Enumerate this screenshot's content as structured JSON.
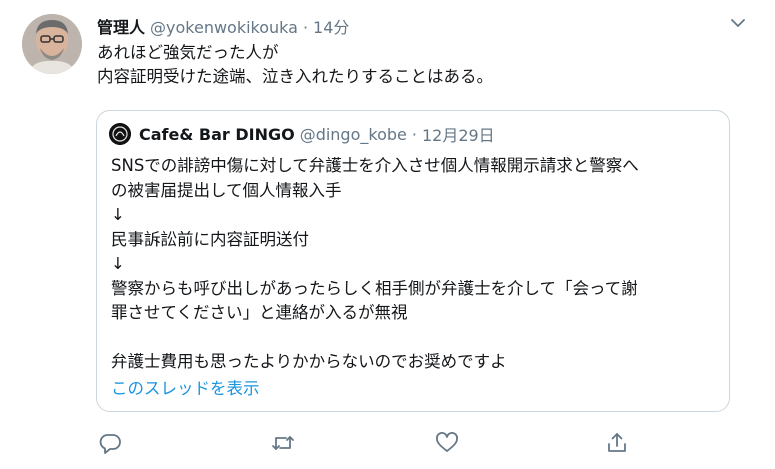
{
  "tweet": {
    "display_name": "管理人",
    "handle": "@yokenwokikouka",
    "separator": "·",
    "time": "14分",
    "text_lines": [
      "あれほど強気だった人が",
      "内容証明受けた途端、泣き入れたりすることはある。"
    ]
  },
  "quote": {
    "display_name": "Cafe& Bar DINGO",
    "handle": "@dingo_kobe",
    "separator": "·",
    "date": "12月29日",
    "lines": [
      "SNSでの誹謗中傷に対して弁護士を介入させ個人情報開示請求と警察へ",
      "の被害届提出して個人情報入手",
      "↓",
      "民事訴訟前に内容証明送付",
      "↓",
      "警察からも呼び出しがあったらしく相手側が弁護士を介して「会って謝",
      "罪させてください」と連絡が入るが無視",
      "",
      "弁護士費用も思ったよりかからないのでお奨めですよ"
    ],
    "show_thread": "このスレッドを表示"
  },
  "icons": {
    "caret": "chevron-down-icon",
    "reply": "reply-icon",
    "retweet": "retweet-icon",
    "like": "heart-icon",
    "share": "share-icon"
  },
  "colors": {
    "secondary_text": "#657786",
    "link": "#1b95e0",
    "border": "#ccd6dd"
  }
}
